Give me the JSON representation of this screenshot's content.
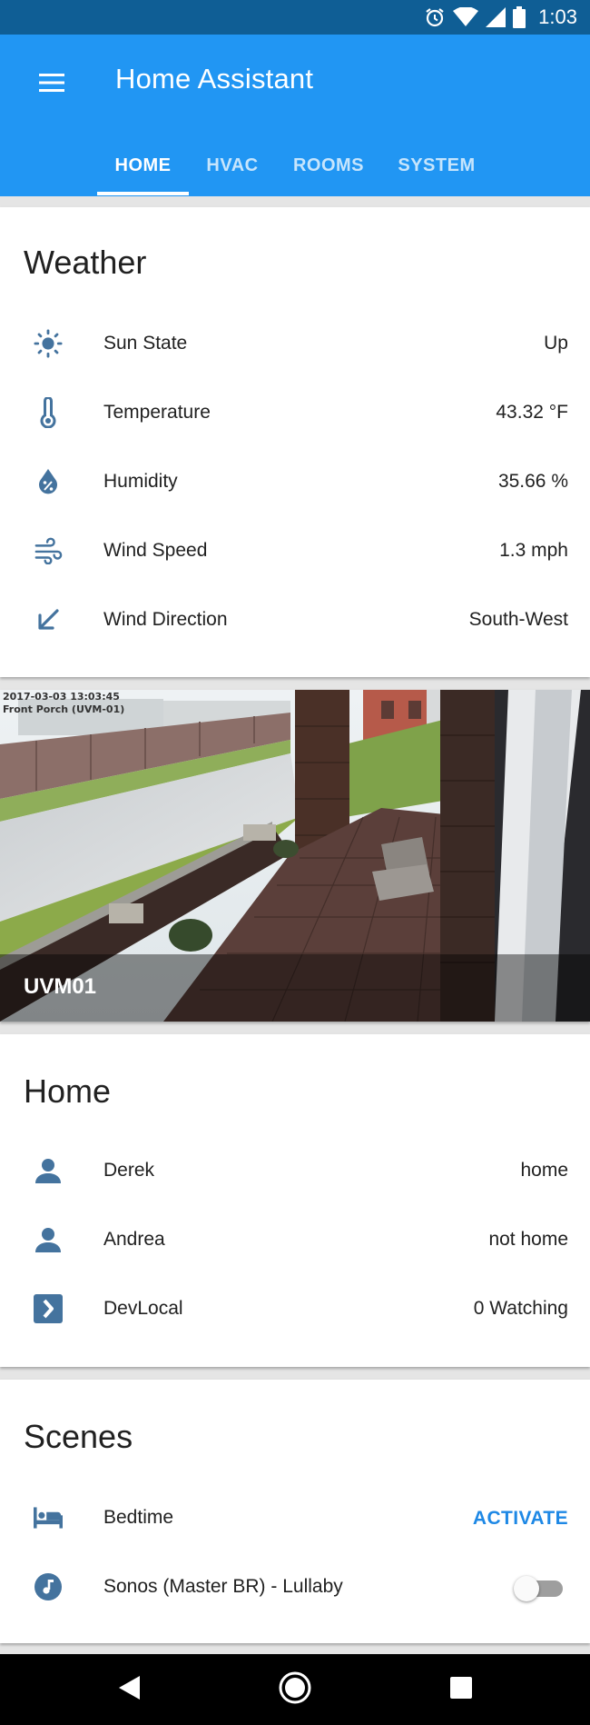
{
  "status_bar": {
    "time": "1:03"
  },
  "app": {
    "title": "Home Assistant"
  },
  "tabs": [
    {
      "label": "HOME"
    },
    {
      "label": "HVAC"
    },
    {
      "label": "ROOMS"
    },
    {
      "label": "SYSTEM"
    }
  ],
  "weather": {
    "title": "Weather",
    "rows": [
      {
        "icon": "sun-icon",
        "name": "Sun State",
        "value": "Up"
      },
      {
        "icon": "thermometer-icon",
        "name": "Temperature",
        "value": "43.32 °F"
      },
      {
        "icon": "humidity-icon",
        "name": "Humidity",
        "value": "35.66 %"
      },
      {
        "icon": "wind-icon",
        "name": "Wind Speed",
        "value": "1.3 mph"
      },
      {
        "icon": "arrow-down-left-icon",
        "name": "Wind Direction",
        "value": "South-West"
      }
    ]
  },
  "camera": {
    "timestamp": "2017-03-03 13:03:45",
    "overlay_name": "Front Porch (UVM-01)",
    "label": "UVM01"
  },
  "home": {
    "title": "Home",
    "rows": [
      {
        "icon": "person-icon",
        "name": "Derek",
        "value": "home"
      },
      {
        "icon": "person-icon",
        "name": "Andrea",
        "value": "not home"
      },
      {
        "icon": "plex-icon",
        "name": "DevLocal",
        "value": "0 Watching"
      }
    ]
  },
  "scenes": {
    "title": "Scenes",
    "rows": [
      {
        "icon": "bed-icon",
        "name": "Bedtime",
        "action": "ACTIVATE"
      },
      {
        "icon": "music-icon",
        "name": "Sonos (Master BR) - Lullaby",
        "toggle_on": false
      }
    ]
  },
  "colors": {
    "app_bar": "#2196f3",
    "status_bar": "#0f5e95",
    "icon": "#44739e",
    "accent": "#1e88e5"
  }
}
